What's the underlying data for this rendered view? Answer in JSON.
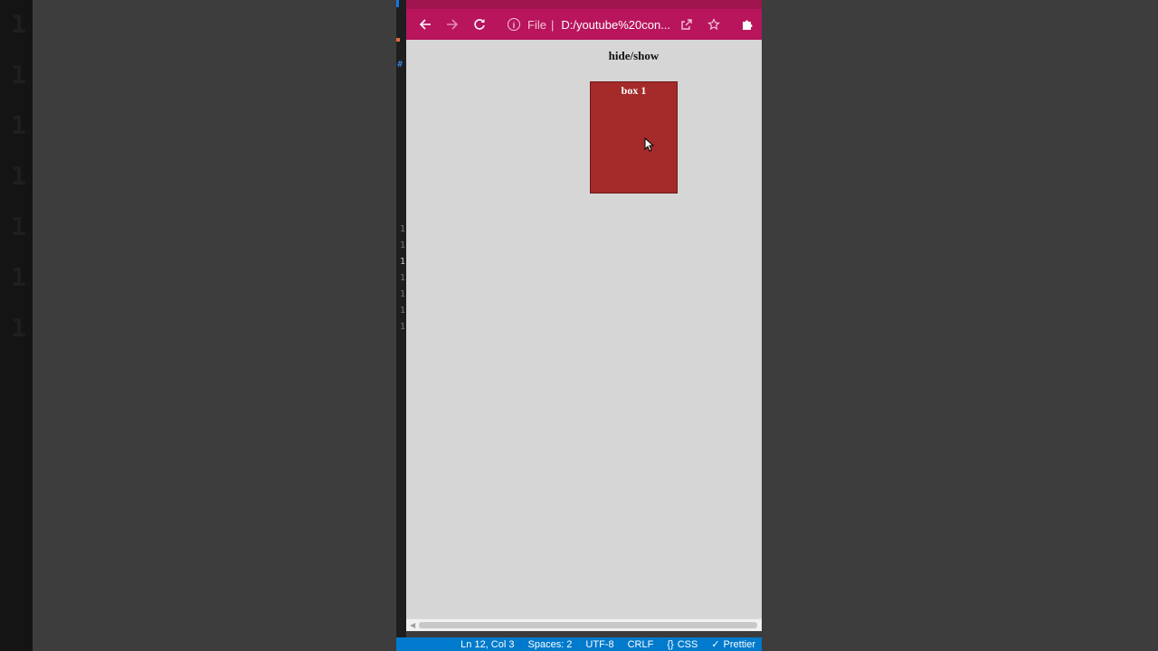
{
  "browser": {
    "address": {
      "scheme": "File",
      "url": "D:/youtube%20con..."
    },
    "icons": [
      "back-arrow-icon",
      "forward-arrow-icon",
      "reload-icon",
      "info-icon",
      "share-icon",
      "star-icon",
      "extensions-icon"
    ],
    "accent_color": "#b8155d"
  },
  "page": {
    "heading": "hide/show",
    "box": {
      "label": "box 1",
      "color": "#a52a2a"
    }
  },
  "editor": {
    "gutter_numbers": [
      "1",
      "1",
      "1",
      "1",
      "1",
      "1",
      "1"
    ]
  },
  "statusbar": {
    "position": "Ln 12, Col 3",
    "spaces": "Spaces: 2",
    "encoding": "UTF-8",
    "eol": "CRLF",
    "language": "CSS",
    "formatter": "Prettier",
    "color": "#007acc"
  },
  "background_digits": [
    "1",
    "1",
    "1",
    "1",
    "1",
    "1",
    "1",
    "1",
    "1",
    "1"
  ]
}
